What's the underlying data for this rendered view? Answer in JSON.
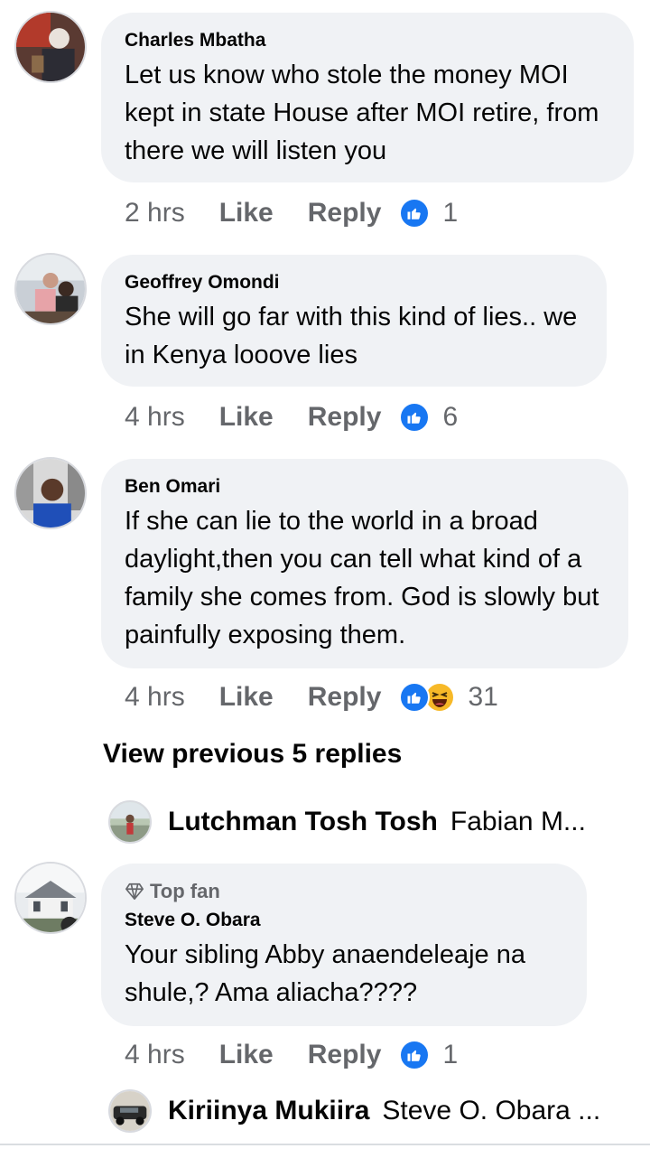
{
  "comments": [
    {
      "author": "Charles Mbatha",
      "text": "Let us know who stole the money MOI kept in state House after MOI retire, from there we will listen you",
      "time": "2 hrs",
      "like_label": "Like",
      "reply_label": "Reply",
      "reactions": [
        "like"
      ],
      "reaction_count": "1"
    },
    {
      "author": "Geoffrey Omondi",
      "text": "She will go far with this kind of lies.. we in Kenya looove lies",
      "time": "4 hrs",
      "like_label": "Like",
      "reply_label": "Reply",
      "reactions": [
        "like"
      ],
      "reaction_count": "6"
    },
    {
      "author": "Ben Omari",
      "text": "If she can lie to the world in a broad daylight,then you can tell what kind of a family she comes from. God is slowly but painfully exposing them.",
      "time": "4 hrs",
      "like_label": "Like",
      "reply_label": "Reply",
      "reactions": [
        "like",
        "haha"
      ],
      "reaction_count": "31"
    },
    {
      "badge": "Top fan",
      "badge_icon": "diamond-icon",
      "author": "Steve O. Obara",
      "text": "Your sibling Abby anaendeleaje na shule,? Ama aliacha????",
      "time": "4 hrs",
      "like_label": "Like",
      "reply_label": "Reply",
      "reactions": [
        "like"
      ],
      "reaction_count": "1"
    }
  ],
  "view_previous": "View previous 5 replies",
  "replies_previews": [
    {
      "author": "Lutchman Tosh Tosh",
      "snippet": "Fabian M..."
    },
    {
      "author": "Kiriinya Mukiira",
      "snippet": "Steve O. Obara ..."
    }
  ],
  "colors": {
    "bubble": "#f0f2f5",
    "secondary_text": "#65676b",
    "like_blue": "#1877f2",
    "haha_yellow": "#f7b928"
  }
}
